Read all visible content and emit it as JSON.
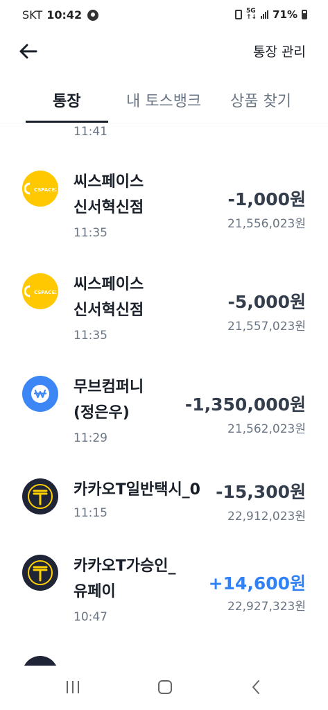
{
  "status_bar": {
    "carrier": "SKT",
    "time": "10:42",
    "battery": "71%"
  },
  "header": {
    "manage_label": "통장 관리"
  },
  "tabs": [
    {
      "label": "통장",
      "active": true
    },
    {
      "label": "내 토스뱅크",
      "active": false
    },
    {
      "label": "상품 찾기",
      "active": false
    }
  ],
  "top_partial_time": "11:41",
  "transactions": [
    {
      "merchant_line1": "씨스페이스",
      "merchant_line2": "신서혁신점",
      "time": "11:35",
      "amount": "-1,000원",
      "balance": "21,556,023원",
      "logo": "cspace-logo-icon",
      "logo_text": "CSPACE24"
    },
    {
      "merchant_line1": "씨스페이스",
      "merchant_line2": "신서혁신점",
      "time": "11:35",
      "amount": "-5,000원",
      "balance": "21,557,023원",
      "logo": "cspace-logo-icon",
      "logo_text": "CSPACE24"
    },
    {
      "merchant_line1": "무브컴퍼니",
      "merchant_line2": "(정은우)",
      "time": "11:29",
      "amount": "-1,350,000원",
      "balance": "21,562,023원",
      "logo": "won-transfer-icon"
    },
    {
      "merchant_line1": "카카오T일반택시_0",
      "merchant_line2": "",
      "time": "11:15",
      "amount": "-15,300원",
      "balance": "22,912,023원",
      "logo": "kakao-t-logo-icon"
    },
    {
      "merchant_line1": "카카오T가승인_",
      "merchant_line2": "유페이",
      "time": "10:47",
      "amount": "+14,600원",
      "balance": "22,927,323원",
      "logo": "kakao-t-logo-icon"
    }
  ],
  "colors": {
    "positive_amount": "#3182f6",
    "cspace_yellow": "#ffc800",
    "kakao_t_dark": "#1f2437",
    "kakao_t_yellow": "#ffd100",
    "move_blue": "#3d86f5"
  }
}
